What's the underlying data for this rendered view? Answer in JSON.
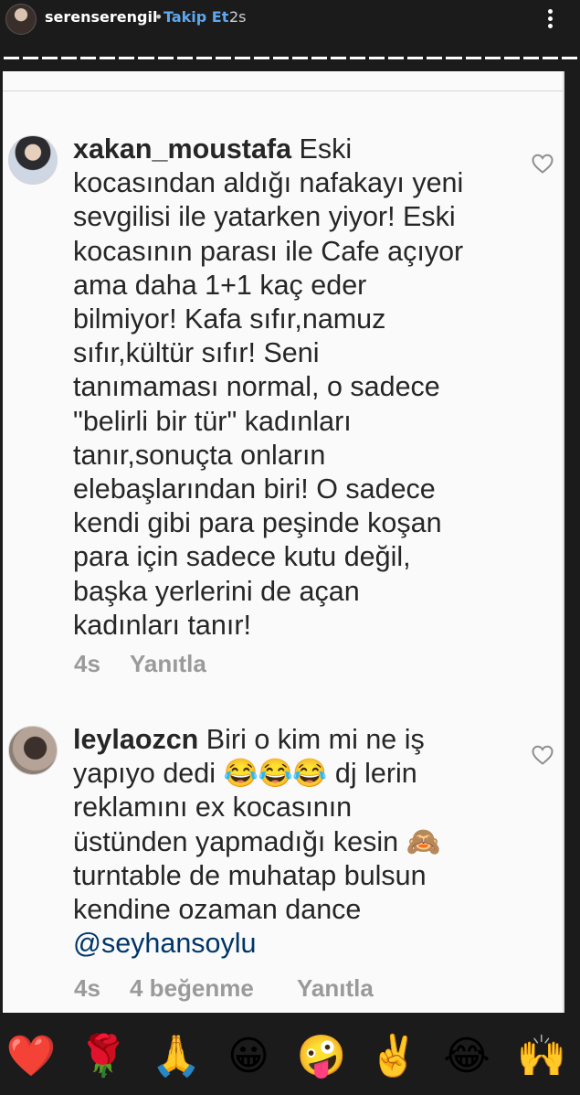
{
  "story": {
    "username": "serenserengil",
    "separator": "•",
    "follow_label": "Takip Et",
    "time": "2s"
  },
  "comments": [
    {
      "username": "xakan_moustafa",
      "text": " Eski\nkocasından aldığı nafakayı yeni\nsevgilisi ile yatarken yiyor! Eski\nkocasının parası ile Cafe açıyor\nama daha 1+1 kaç eder\nbilmiyor! Kafa sıfır,namuz\nsıfır,kültür sıfır! Seni\ntanımaması normal, o sadece\n\"belirli bir tür\" kadınları\ntanır,sonuçta onların\nelebaşlarından biri! O sadece\nkendi gibi para peşinde koşan\npara için sadece kutu değil,\nbaşka yerlerini de açan\nkadınları tanır!",
      "time": "4s",
      "reply_label": "Yanıtla"
    },
    {
      "username": "leylaozcn",
      "text": " Biri o kim mi ne iş\nyapıyo dedi 😂😂😂 dj lerin\nreklamını ex kocasının\nüstünden yapmadığı kesin 🙈\nturntable de muhatap bulsun\nkendine ozaman dance\n",
      "mention": "@seyhansoylu",
      "time": "4s",
      "likes": "4 beğenme",
      "reply_label": "Yanıtla"
    }
  ],
  "reactions": [
    "❤️",
    "🌹",
    "🙏",
    "😀",
    "🤪",
    "✌️",
    "😂",
    "🙌"
  ],
  "icons": {
    "more": "more-vertical-icon",
    "like": "heart-outline-icon"
  },
  "colors": {
    "follow": "#5ea7ee",
    "mention": "#003569",
    "meta": "#9a9a9a"
  }
}
